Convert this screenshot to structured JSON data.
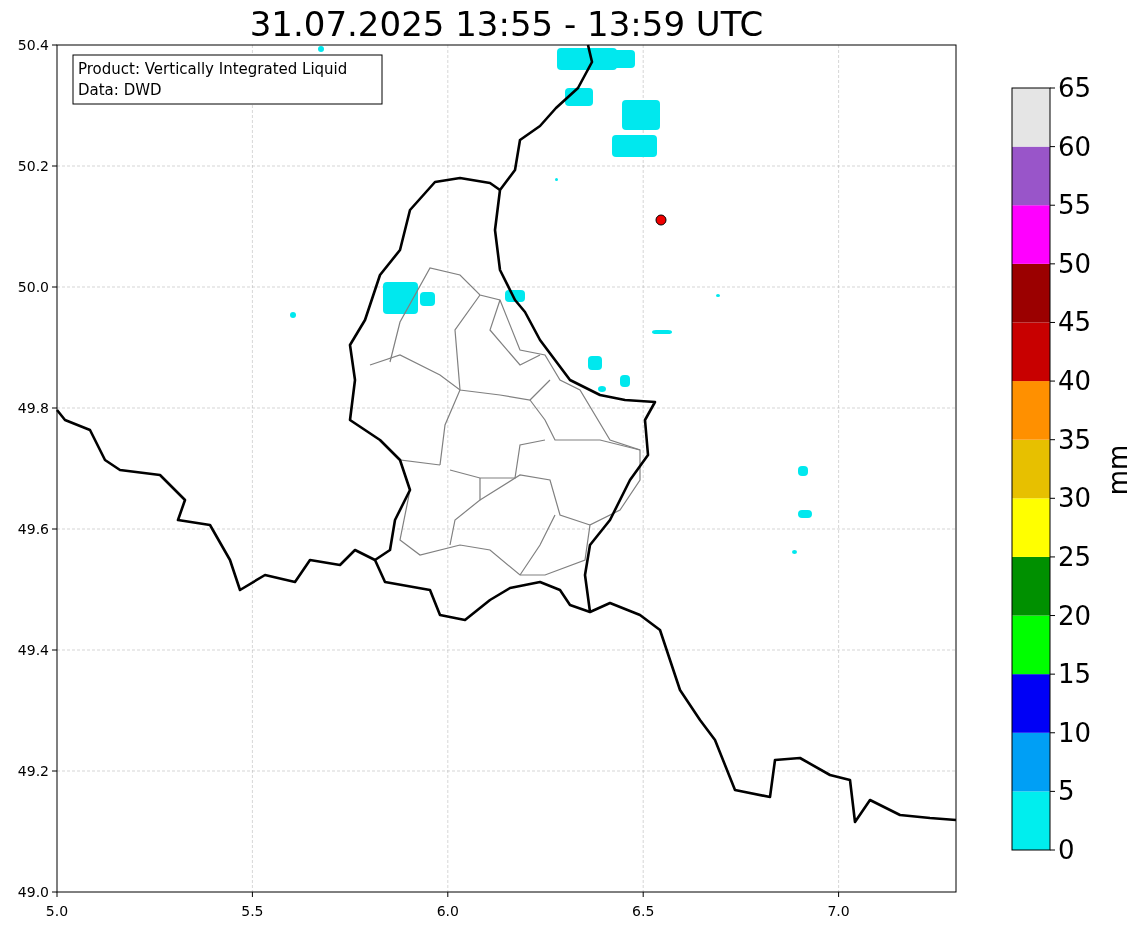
{
  "title": "31.07.2025 13:55 - 13:59 UTC",
  "info": [
    "Product: Vertically Integrated Liquid",
    "Data: DWD"
  ],
  "x_axis": {
    "ticks": [
      "5.0",
      "5.5",
      "6.0",
      "6.5",
      "7.0"
    ]
  },
  "y_axis": {
    "ticks": [
      "50.4",
      "50.2",
      "50.0",
      "49.8",
      "49.6",
      "49.4",
      "49.2",
      "49.0"
    ]
  },
  "colorbar": {
    "label": "mm",
    "ticks": [
      "65",
      "60",
      "55",
      "50",
      "45",
      "40",
      "35",
      "30",
      "25",
      "20",
      "15",
      "10",
      "5",
      "0"
    ],
    "bins": [
      {
        "color": "#00eeee"
      },
      {
        "color": "#009ff5"
      },
      {
        "color": "#0000f6"
      },
      {
        "color": "#00ff00"
      },
      {
        "color": "#009000"
      },
      {
        "color": "#ffff00"
      },
      {
        "color": "#e7c000"
      },
      {
        "color": "#ff9000"
      },
      {
        "color": "#c80000"
      },
      {
        "color": "#9b0000"
      },
      {
        "color": "#ff00ff"
      },
      {
        "color": "#9955c9"
      },
      {
        "color": "#e5e5e5"
      }
    ]
  }
}
